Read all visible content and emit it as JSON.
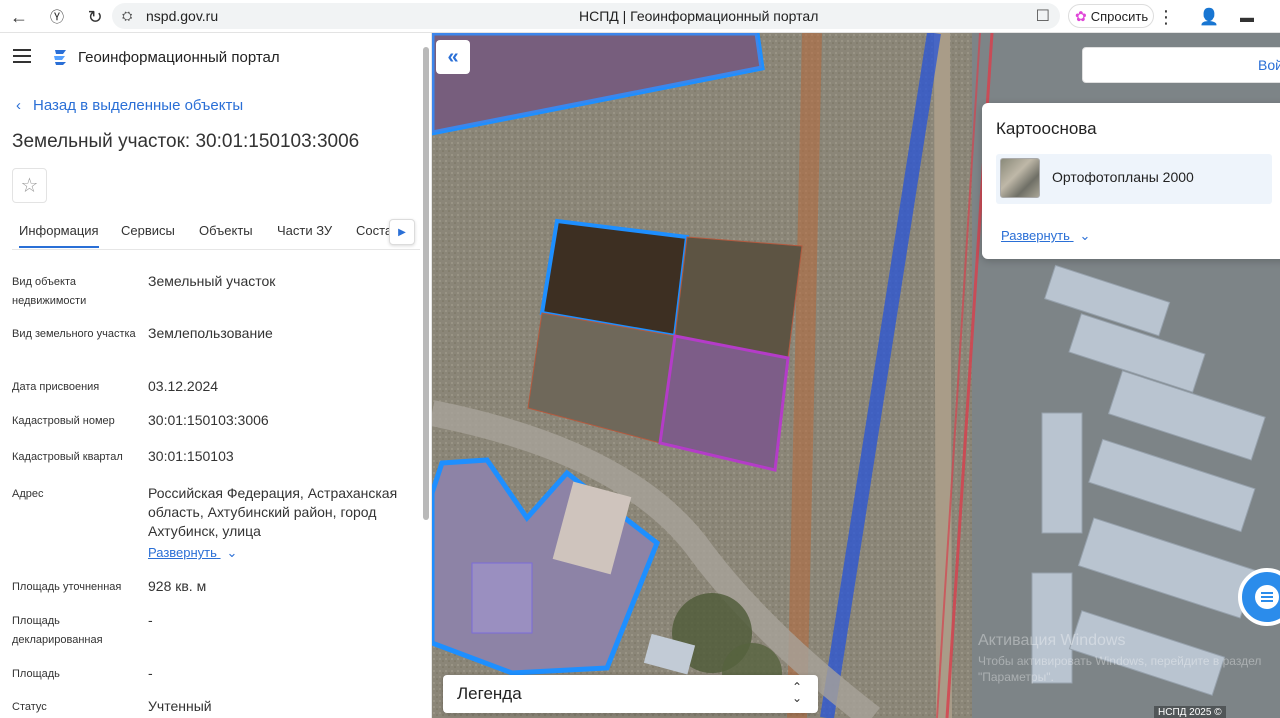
{
  "browser": {
    "url": "nspd.gov.ru",
    "tab_title": "НСПД | Геоинформационный портал",
    "ask_label": "Спросить"
  },
  "sidebar": {
    "portal_title": "Геоинформационный портал",
    "back_link": "Назад в выделенные объекты",
    "object_title": "Земельный участок: 30:01:150103:3006",
    "tabs": [
      "Информация",
      "Сервисы",
      "Объекты",
      "Части ЗУ",
      "Соста"
    ],
    "active_tab": "Информация",
    "fields": [
      {
        "label": "Вид объекта недвижимости",
        "value": "Земельный участок"
      },
      {
        "label": "Вид земельного участка",
        "value": "Землепользование"
      },
      {
        "label": "Дата присвоения",
        "value": "03.12.2024"
      },
      {
        "label": "Кадастровый номер",
        "value": "30:01:150103:3006"
      },
      {
        "label": "Кадастровый квартал",
        "value": "30:01:150103"
      },
      {
        "label": "Адрес",
        "value": "Российская Федерация, Астраханская область, Ахтубинский район, город Ахтубинск, улица"
      },
      {
        "label": "Площадь уточненная",
        "value": "928 кв. м"
      },
      {
        "label": "Площадь декларированная",
        "value": "-"
      },
      {
        "label": "Площадь",
        "value": "-"
      },
      {
        "label": "Статус",
        "value": "Учтенный"
      }
    ],
    "expand_label": "Развернуть"
  },
  "map": {
    "search_button": "Вой",
    "basemap_title": "Картооснова",
    "basemap_item": "Ортофотопланы 2000",
    "basemap_expand": "Развернуть",
    "legend_label": "Легенда",
    "watermark_title": "Активация Windows",
    "watermark_sub": "Чтобы активировать Windows, перейдите в раздел \"Параметры\".",
    "copyright": "НСПД 2025 ©"
  },
  "colors": {
    "accent": "#2a6fd6",
    "parcel_blue": "#1e8fff",
    "parcel_purple": "#b43cc8",
    "parcel_red": "#d04a3a"
  }
}
